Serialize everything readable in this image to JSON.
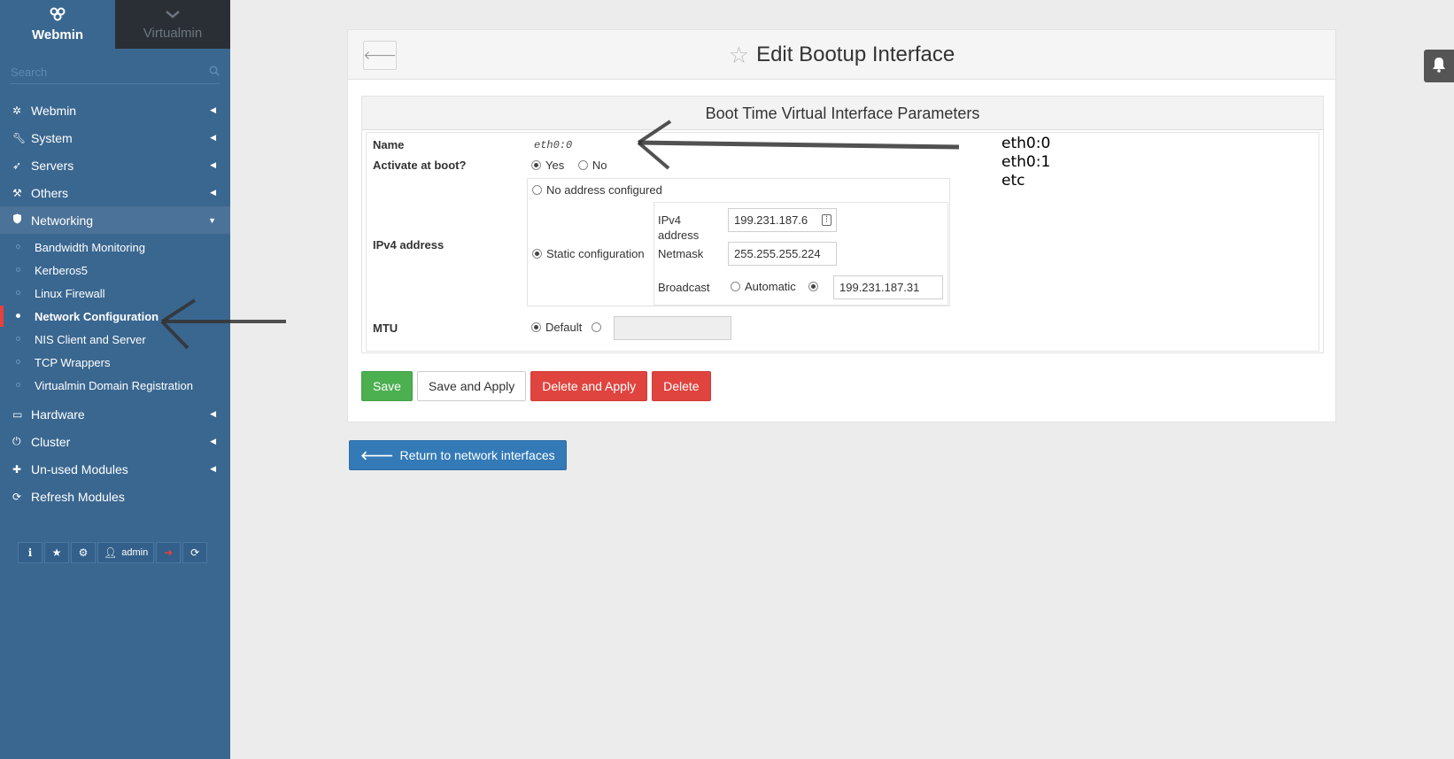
{
  "sidebar": {
    "tabs": [
      {
        "label": "Webmin",
        "icon": "webmin-logo-icon"
      },
      {
        "label": "Virtualmin",
        "icon": "chevron-down-icon"
      }
    ],
    "search": {
      "placeholder": "Search"
    },
    "menu": [
      {
        "label": "Webmin",
        "icon": "gear-icon"
      },
      {
        "label": "System",
        "icon": "wrench-icon"
      },
      {
        "label": "Servers",
        "icon": "rocket-icon"
      },
      {
        "label": "Others",
        "icon": "gavel-icon"
      },
      {
        "label": "Networking",
        "icon": "shield-icon"
      }
    ],
    "networking_items": [
      "Bandwidth Monitoring",
      "Kerberos5",
      "Linux Firewall",
      "Network Configuration",
      "NIS Client and Server",
      "TCP Wrappers",
      "Virtualmin Domain Registration"
    ],
    "menu_after": [
      {
        "label": "Hardware",
        "icon": "hdd-icon"
      },
      {
        "label": "Cluster",
        "icon": "power-icon"
      },
      {
        "label": "Un-used Modules",
        "icon": "puzzle-icon"
      },
      {
        "label": "Refresh Modules",
        "icon": "refresh-icon"
      }
    ],
    "footer": {
      "user_label": "admin"
    }
  },
  "page": {
    "title": "Edit Bootup Interface"
  },
  "form": {
    "section_title": "Boot Time Virtual Interface Parameters",
    "name_label": "Name",
    "name_value": "eth0:0",
    "activate_label": "Activate at boot?",
    "activate_yes": "Yes",
    "activate_no": "No",
    "ipv4_label": "IPv4 address",
    "no_address": "No address configured",
    "static_config": "Static configuration",
    "ipv4_field_label_1": "IPv4",
    "ipv4_field_label_2": "address",
    "ipv4_value": "199.231.187.6",
    "netmask_label": "Netmask",
    "netmask_value": "255.255.255.224",
    "broadcast_label": "Broadcast",
    "broadcast_auto": "Automatic",
    "broadcast_value": "199.231.187.31",
    "mtu_label": "MTU",
    "mtu_default": "Default",
    "mtu_value": ""
  },
  "buttons": {
    "save": "Save",
    "save_apply": "Save and Apply",
    "delete_apply": "Delete and Apply",
    "delete": "Delete",
    "return": "Return to network interfaces"
  },
  "annotation": {
    "lines": [
      "eth0:0",
      "eth0:1",
      "etc"
    ]
  },
  "colors": {
    "sidebar_bg": "#3a6790",
    "save_green": "#4caf50",
    "delete_red": "#e0443f",
    "return_blue": "#337ab7",
    "active_marker": "#e8413b"
  }
}
